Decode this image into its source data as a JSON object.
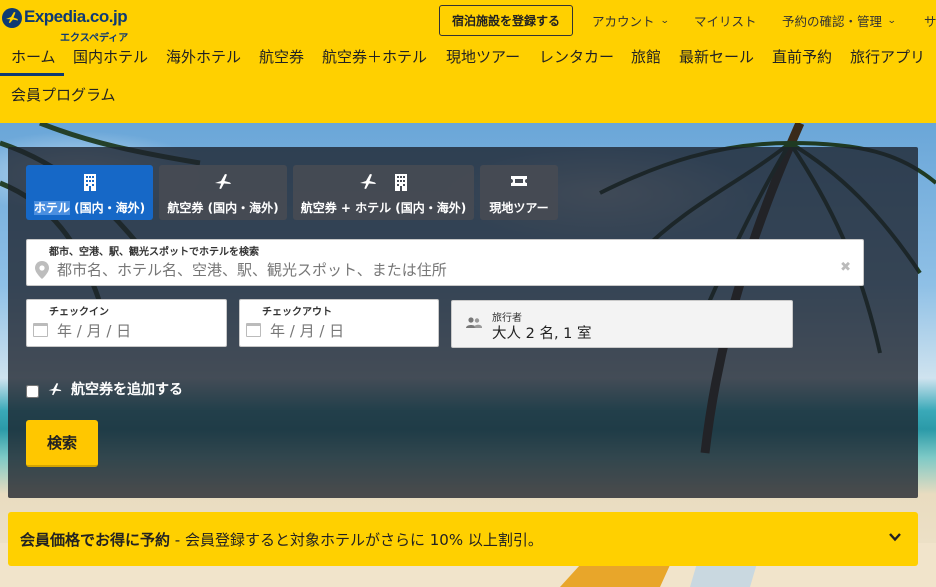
{
  "logo": {
    "wordmark": "Expedia.co.jp",
    "kana": "エクスペディア"
  },
  "header": {
    "register_label": "宿泊施設を登録する",
    "account_label": "アカウント",
    "mylist_label": "マイリスト",
    "booking_label": "予約の確認・管理",
    "support_label": "サ"
  },
  "nav": {
    "items": [
      {
        "label": "ホーム"
      },
      {
        "label": "国内ホテル"
      },
      {
        "label": "海外ホテル"
      },
      {
        "label": "航空券"
      },
      {
        "label": "航空券＋ホテル"
      },
      {
        "label": "現地ツアー"
      },
      {
        "label": "レンタカー"
      },
      {
        "label": "旅館"
      },
      {
        "label": "最新セール"
      },
      {
        "label": "直前予約"
      },
      {
        "label": "旅行アプリ"
      },
      {
        "label": "会員プログラム"
      }
    ],
    "active_index": 0
  },
  "tabs": [
    {
      "label_highlight": "ホテル",
      "label_rest": " (国内・海外)",
      "icons": [
        "building-icon"
      ],
      "active": true
    },
    {
      "label": "航空券 (国内・海外)",
      "icons": [
        "airplane-icon"
      ],
      "active": false
    },
    {
      "label": "航空券 + ホテル (国内・海外)",
      "icons": [
        "airplane-icon",
        "building-icon"
      ],
      "active": false
    },
    {
      "label": "現地ツアー",
      "icons": [
        "ticket-icon"
      ],
      "active": false
    }
  ],
  "search": {
    "destination_label": "都市、空港、駅、観光スポットでホテルを検索",
    "destination_placeholder": "都市名、ホテル名、空港、駅、観光スポット、または住所",
    "checkin_label": "チェックイン",
    "checkout_label": "チェックアウト",
    "date_placeholder": "年 / 月 / 日",
    "travellers_label": "旅行者",
    "travellers_value": "大人 2 名, 1 室",
    "add_flight_label": "航空券を追加する",
    "add_flight_checked": false,
    "search_button": "検索"
  },
  "banner": {
    "bold": "会員価格でお得に予約",
    "rest": " - 会員登録すると対象ホテルがさらに 10% 以上割引。"
  },
  "colors": {
    "brand_yellow": "#ffd000",
    "brand_navy": "#0e3a73",
    "tab_active": "#1668c7",
    "search_button": "#ffc700"
  }
}
